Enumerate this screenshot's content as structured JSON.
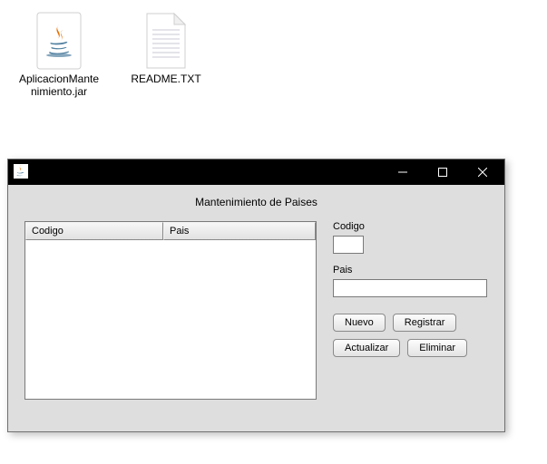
{
  "desktop": {
    "files": [
      {
        "label": "AplicacionMantenimiento.jar",
        "icon": "java"
      },
      {
        "label": "README.TXT",
        "icon": "text"
      }
    ]
  },
  "window": {
    "app_title": "Mantenimiento de Paises",
    "table": {
      "columns": {
        "codigo": "Codigo",
        "pais": "Pais"
      }
    },
    "form": {
      "codigo_label": "Codigo",
      "codigo_value": "",
      "pais_label": "Pais",
      "pais_value": ""
    },
    "buttons": {
      "nuevo": "Nuevo",
      "registrar": "Registrar",
      "actualizar": "Actualizar",
      "eliminar": "Eliminar"
    }
  }
}
